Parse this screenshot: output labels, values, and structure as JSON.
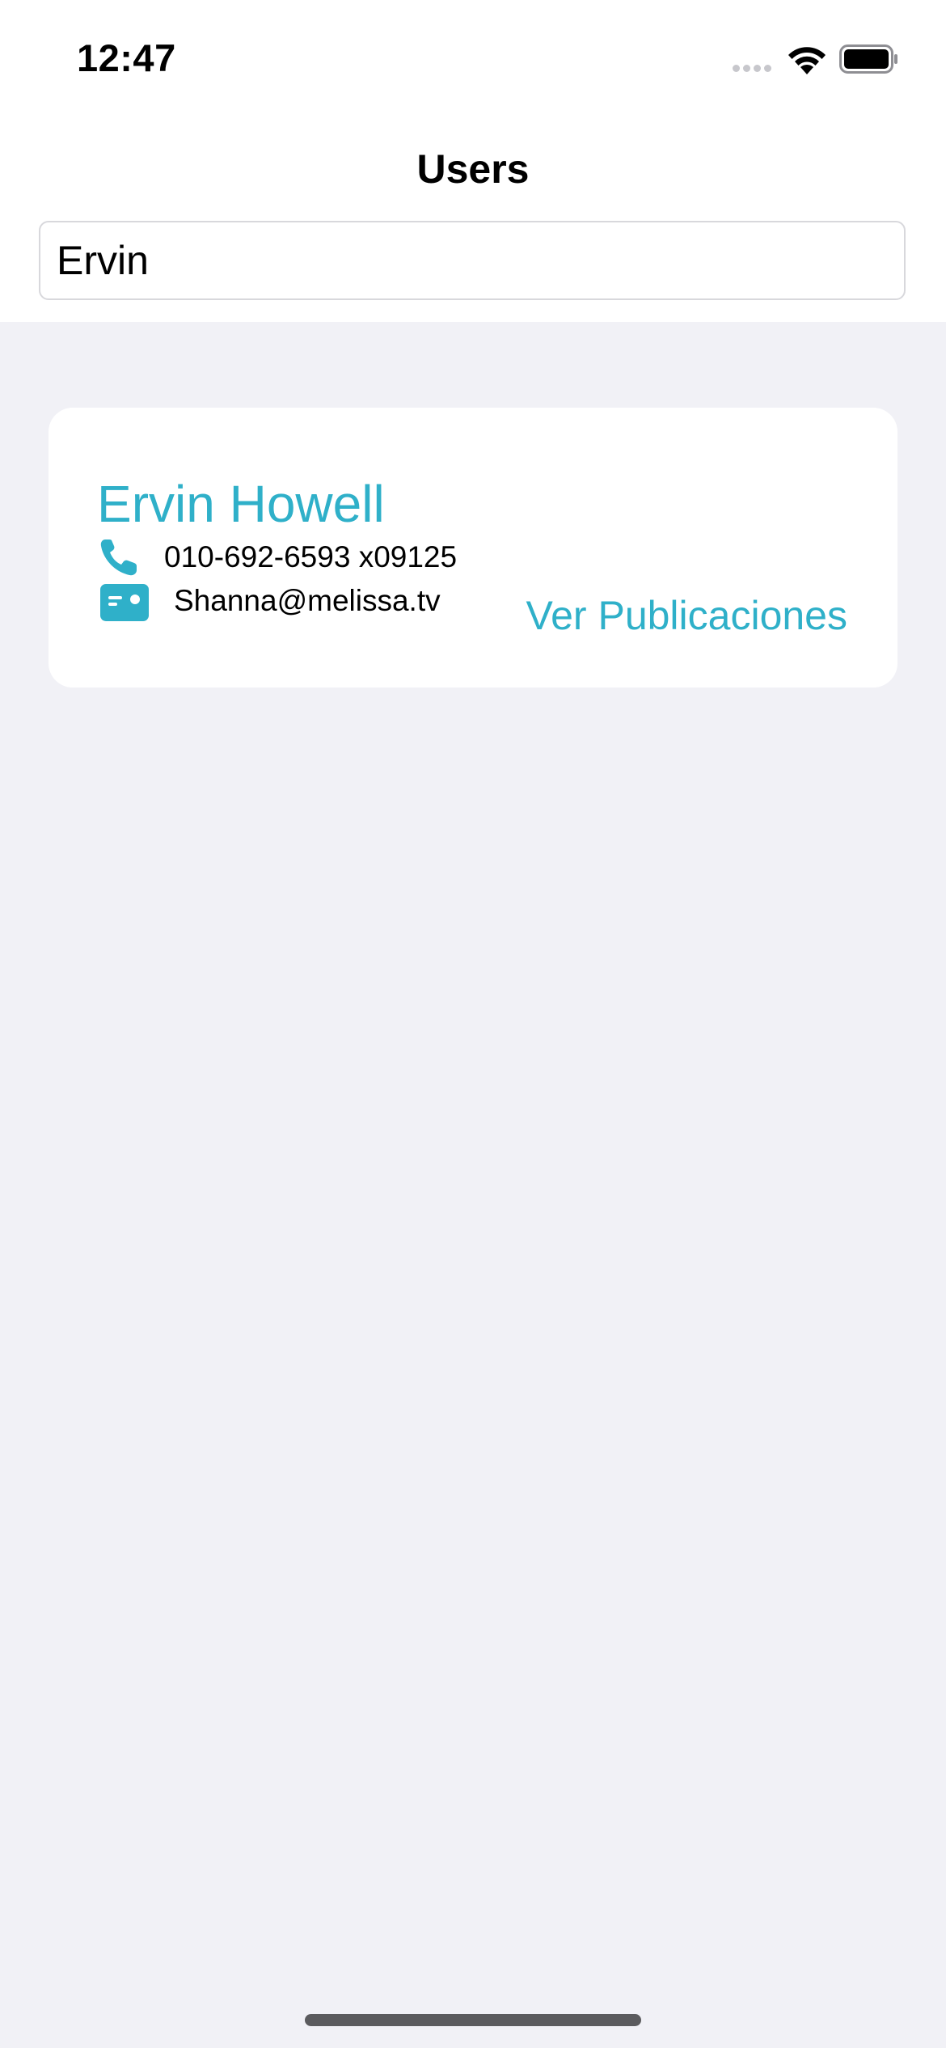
{
  "status_bar": {
    "time": "12:47"
  },
  "nav": {
    "title": "Users"
  },
  "search": {
    "value": "Ervin"
  },
  "users": [
    {
      "name": "Ervin Howell",
      "phone": "010-692-6593 x09125",
      "email": "Shanna@melissa.tv",
      "action_label": "Ver Publicaciones"
    }
  ],
  "colors": {
    "accent": "#2fb0c9",
    "background": "#f1f1f6",
    "card": "#ffffff"
  },
  "icons": {
    "phone": "phone-icon",
    "email": "id-card-icon",
    "wifi": "wifi-icon",
    "battery": "battery-icon"
  }
}
